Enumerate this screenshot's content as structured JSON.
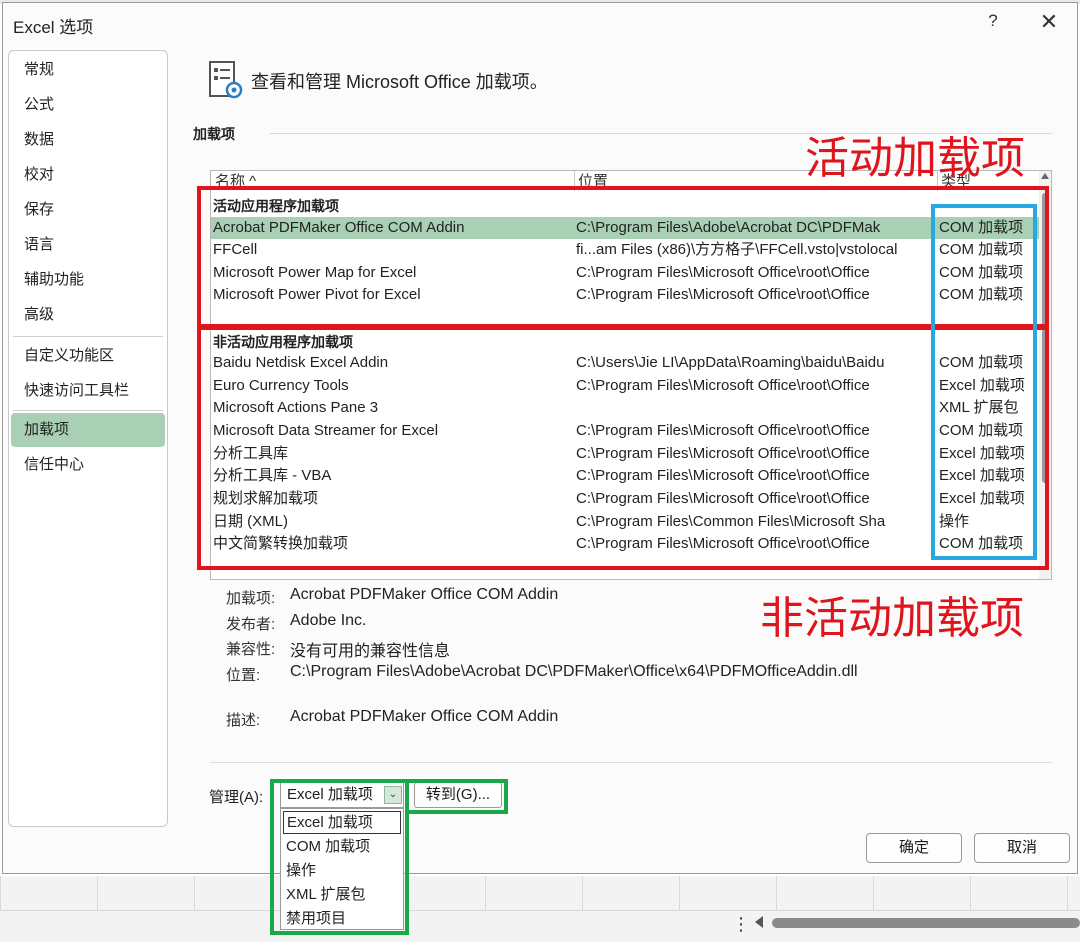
{
  "dialog": {
    "title": "Excel 选项",
    "help": "?",
    "close": "✕"
  },
  "sidebar": {
    "items": [
      {
        "label": "常规"
      },
      {
        "label": "公式"
      },
      {
        "label": "数据"
      },
      {
        "label": "校对"
      },
      {
        "label": "保存"
      },
      {
        "label": "语言"
      },
      {
        "label": "辅助功能"
      },
      {
        "label": "高级"
      },
      {
        "label": "自定义功能区"
      },
      {
        "label": "快速访问工具栏"
      },
      {
        "label": "加载项",
        "active": true
      },
      {
        "label": "信任中心"
      }
    ]
  },
  "header": {
    "text": "查看和管理 Microsoft Office 加载项。",
    "icon": "addin-manage-icon"
  },
  "section": {
    "label": "加载项"
  },
  "table": {
    "columns": [
      "名称 ^",
      "位置",
      "类型"
    ],
    "active_group": "活动应用程序加载项",
    "active_rows": [
      {
        "name": "Acrobat PDFMaker Office COM Addin",
        "location": "C:\\Program Files\\Adobe\\Acrobat DC\\PDFMak",
        "type": "COM 加载项"
      },
      {
        "name": "FFCell",
        "location": "fi...am Files (x86)\\方方格子\\FFCell.vsto|vstolocal",
        "type": "COM 加载项"
      },
      {
        "name": "Microsoft Power Map for Excel",
        "location": "C:\\Program Files\\Microsoft Office\\root\\Office",
        "type": "COM 加载项"
      },
      {
        "name": "Microsoft Power Pivot for Excel",
        "location": "C:\\Program Files\\Microsoft Office\\root\\Office",
        "type": "COM 加载项"
      }
    ],
    "inactive_group": "非活动应用程序加载项",
    "inactive_rows": [
      {
        "name": "Baidu Netdisk Excel Addin",
        "location": "C:\\Users\\Jie LI\\AppData\\Roaming\\baidu\\Baidu",
        "type": "COM 加载项"
      },
      {
        "name": "Euro Currency Tools",
        "location": "C:\\Program Files\\Microsoft Office\\root\\Office",
        "type": "Excel 加载项"
      },
      {
        "name": "Microsoft Actions Pane 3",
        "location": "",
        "type": "XML 扩展包"
      },
      {
        "name": "Microsoft Data Streamer for Excel",
        "location": "C:\\Program Files\\Microsoft Office\\root\\Office",
        "type": "COM 加载项"
      },
      {
        "name": "分析工具库",
        "location": "C:\\Program Files\\Microsoft Office\\root\\Office",
        "type": "Excel 加载项"
      },
      {
        "name": "分析工具库 - VBA",
        "location": "C:\\Program Files\\Microsoft Office\\root\\Office",
        "type": "Excel 加载项"
      },
      {
        "name": "规划求解加载项",
        "location": "C:\\Program Files\\Microsoft Office\\root\\Office",
        "type": "Excel 加载项"
      },
      {
        "name": "日期 (XML)",
        "location": "C:\\Program Files\\Common Files\\Microsoft Sha",
        "type": "操作"
      },
      {
        "name": "中文简繁转换加载项",
        "location": "C:\\Program Files\\Microsoft Office\\root\\Office",
        "type": "COM 加载项"
      }
    ]
  },
  "details": {
    "addin_label": "加载项:",
    "addin_value": "Acrobat PDFMaker Office COM Addin",
    "publisher_label": "发布者:",
    "publisher_value": "Adobe Inc.",
    "compat_label": "兼容性:",
    "compat_value": "没有可用的兼容性信息",
    "location_label": "位置:",
    "location_value": "C:\\Program Files\\Adobe\\Acrobat DC\\PDFMaker\\Office\\x64\\PDFMOfficeAddin.dll",
    "desc_label": "描述:",
    "desc_value": "Acrobat PDFMaker Office COM Addin"
  },
  "manage": {
    "label": "管理(A):",
    "selected": "Excel 加载项",
    "goto": "转到(G)...",
    "options": [
      "Excel 加载项",
      "COM 加载项",
      "操作",
      "XML 扩展包",
      "禁用项目"
    ]
  },
  "buttons": {
    "ok": "确定",
    "cancel": "取消"
  },
  "annotations": {
    "active_label": "活动加载项",
    "inactive_label": "非活动加载项",
    "colors": {
      "red": "#e0141c",
      "blue": "#28a8e0",
      "green": "#1aa84a",
      "selection": "#a9d0b4"
    }
  }
}
